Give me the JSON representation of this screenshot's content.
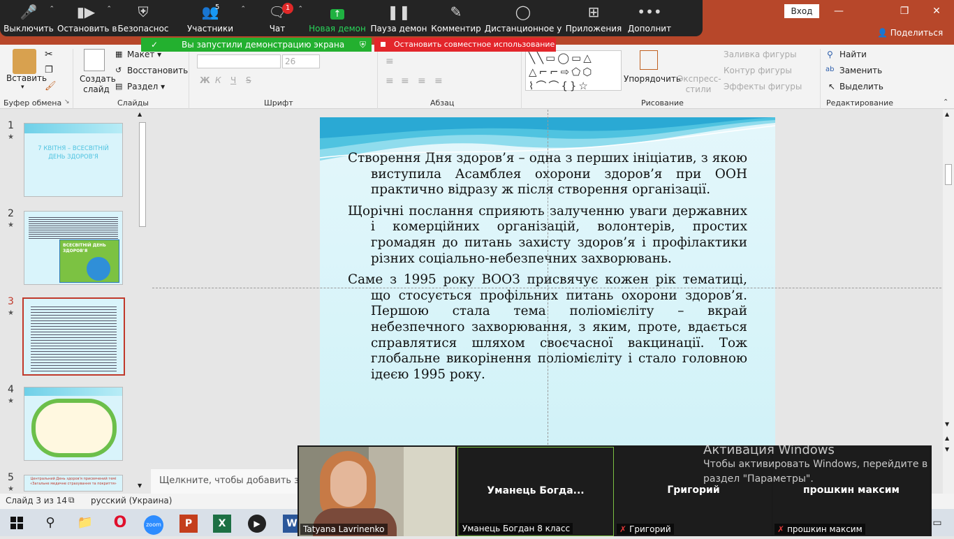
{
  "zoom_toolbar": {
    "buttons": [
      {
        "label": "Выключить",
        "icon": "mic-icon"
      },
      {
        "label": "Остановить в",
        "icon": "video-camera-icon"
      },
      {
        "label": "Безопаснос",
        "icon": "shield-icon"
      },
      {
        "label": "Участники",
        "icon": "participants-icon",
        "count": "5"
      },
      {
        "label": "Чат",
        "icon": "chat-icon",
        "badge": "1"
      },
      {
        "label": "Новая демон",
        "icon": "share-screen-icon"
      },
      {
        "label": "Пауза демон",
        "icon": "pause-icon"
      },
      {
        "label": "Комментир",
        "icon": "pencil-icon"
      },
      {
        "label": "Дистанционное у",
        "icon": "mouse-icon"
      },
      {
        "label": "Приложения",
        "icon": "apps-icon"
      },
      {
        "label": "Дополнит",
        "icon": "more-icon"
      }
    ]
  },
  "share_banner": {
    "green_text": "Вы запустили демонстрацию экрана",
    "red_text": "Остановить совместное использование"
  },
  "titlebar": {
    "login_label": "Вход",
    "share_label": "Поделиться"
  },
  "ribbon": {
    "clipboard": {
      "paste_label": "Вставить",
      "group_label": "Буфер обмена"
    },
    "slides": {
      "new_slide_label": "Создать слайд",
      "layout_label": "Макет",
      "reset_label": "Восстановить",
      "section_label": "Раздел",
      "group_label": "Слайды"
    },
    "font": {
      "size_value": "26",
      "group_label": "Шрифт",
      "bold": "Ж",
      "italic": "К",
      "underline": "Ч",
      "strike": "S"
    },
    "paragraph": {
      "group_label": "Абзац"
    },
    "drawing": {
      "arrange_label": "Упорядочить",
      "quick_styles_label": "Экспресс-стили",
      "fill_label": "Заливка фигуры",
      "outline_label": "Контур фигуры",
      "effects_label": "Эффекты фигуры",
      "group_label": "Рисование"
    },
    "editing": {
      "find_label": "Найти",
      "replace_label": "Заменить",
      "select_label": "Выделить",
      "group_label": "Редактирование"
    }
  },
  "thumbnails": [
    {
      "number": "1",
      "title": "7 КВІТНЯ – ВСЕСВІТНІЙ ДЕНЬ ЗДОРОВ'Я"
    },
    {
      "number": "2",
      "caption": "ВСЕСВІТНІЙ ДЕНЬ ЗДОРОВ'Я"
    },
    {
      "number": "3"
    },
    {
      "number": "4"
    },
    {
      "number": "5",
      "caption": "Центральний День здоров'я присвячений темі «Загальне медичне страхування та покриття»"
    }
  ],
  "slide": {
    "paragraphs": [
      "Створення Дня здоров’я – одна з перших ініціатив, з якою виступила Асамблея охорони здоров’я при ООН практично відразу ж після створення організації.",
      "Щорічні послання сприяють залученню уваги державних і комерційних організацій, волонтерів, простих громадян до питань захисту здоров’я і профілактики різних соціально-небезпечних захворювань.",
      "Саме з 1995 року ВООЗ присвячує кожен рік тематиці, що стосується профільних питань охорони здоров’я. Першою стала тема поліомієліту – вкрай небезпечного захворювання, з яким, проте, вдається справлятися шляхом своєчасної вакцинації. Тож глобальне викорінення поліомієліту і стало головною ідеєю 1995 року."
    ]
  },
  "notes_placeholder": "Щелкните, чтобы добавить за",
  "status_bar": {
    "slide_counter": "Слайд 3 из 14",
    "language": "русский (Украина)"
  },
  "video": {
    "tiles": [
      {
        "label": "Tatyana Lavrinenko",
        "muted": false,
        "has_video": true
      },
      {
        "name": "Уманець  Богда...",
        "label": "Уманець Богдан 8 класс",
        "muted": false
      },
      {
        "name": "Григорий",
        "label": "Григорий",
        "muted": true
      },
      {
        "name": "прошкин максим",
        "label": "прошкин максим",
        "muted": true
      }
    ]
  },
  "watermark": {
    "title": "Активация Windows",
    "line1": "Чтобы активировать Windows, перейдите в",
    "line2": "раздел \"Параметры\"."
  },
  "taskbar": {
    "apps": [
      "windows-start-icon",
      "search-icon",
      "file-explorer-icon",
      "opera-icon",
      "zoom-icon",
      "powerpoint-icon",
      "excel-icon",
      "media-player-icon",
      "word-icon"
    ],
    "zoom_label": "zoom"
  },
  "colors": {
    "powerpoint_red": "#b7472a",
    "zoom_green": "#23b02f",
    "stop_red": "#e3262b",
    "selected_thumb": "#c0392b"
  }
}
